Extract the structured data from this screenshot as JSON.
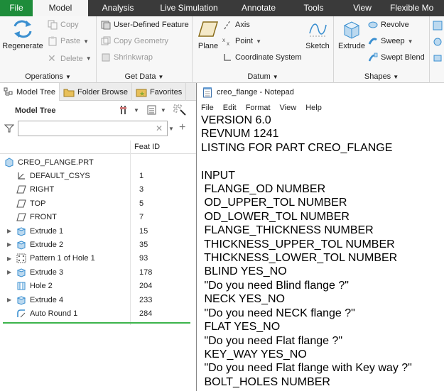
{
  "ribbon_tabs": [
    "File",
    "Model",
    "Analysis",
    "Live Simulation",
    "Annotate",
    "Tools",
    "View",
    "Flexible Mo"
  ],
  "ribbon": {
    "operations": {
      "label": "Operations",
      "regenerate": "Regenerate",
      "copy": "Copy",
      "paste": "Paste",
      "delete": "Delete"
    },
    "get_data": {
      "label": "Get Data",
      "udf": "User-Defined Feature",
      "copy_geometry": "Copy Geometry",
      "shrinkwrap": "Shrinkwrap"
    },
    "datum": {
      "label": "Datum",
      "plane": "Plane",
      "axis": "Axis",
      "point": "Point",
      "coord_sys": "Coordinate System",
      "sketch": "Sketch"
    },
    "shapes": {
      "label": "Shapes",
      "extrude": "Extrude",
      "revolve": "Revolve",
      "sweep": "Sweep",
      "swept_blend": "Swept Blend"
    }
  },
  "panel_tabs": [
    "Model Tree",
    "Folder Browse",
    "Favorites"
  ],
  "model_tree": {
    "title": "Model Tree",
    "filter_placeholder": "",
    "column_feat_id": "Feat ID",
    "items": [
      {
        "label": "CREO_FLANGE.PRT",
        "feat_id": "",
        "icon": "part-icon",
        "expandable": false,
        "indent": 0
      },
      {
        "label": "DEFAULT_CSYS",
        "feat_id": "1",
        "icon": "csys-icon",
        "expandable": false,
        "indent": 1
      },
      {
        "label": "RIGHT",
        "feat_id": "3",
        "icon": "datum-plane-icon",
        "expandable": false,
        "indent": 1
      },
      {
        "label": "TOP",
        "feat_id": "5",
        "icon": "datum-plane-icon",
        "expandable": false,
        "indent": 1
      },
      {
        "label": "FRONT",
        "feat_id": "7",
        "icon": "datum-plane-icon",
        "expandable": false,
        "indent": 1
      },
      {
        "label": "Extrude 1",
        "feat_id": "15",
        "icon": "extrude-icon",
        "expandable": true,
        "indent": 1
      },
      {
        "label": "Extrude 2",
        "feat_id": "35",
        "icon": "extrude-icon",
        "expandable": true,
        "indent": 1
      },
      {
        "label": "Pattern 1 of Hole 1",
        "feat_id": "93",
        "icon": "pattern-icon",
        "expandable": true,
        "indent": 1
      },
      {
        "label": "Extrude 3",
        "feat_id": "178",
        "icon": "extrude-icon",
        "expandable": true,
        "indent": 1
      },
      {
        "label": "Hole 2",
        "feat_id": "204",
        "icon": "hole-icon",
        "expandable": false,
        "indent": 1
      },
      {
        "label": "Extrude 4",
        "feat_id": "233",
        "icon": "extrude-icon",
        "expandable": true,
        "indent": 1
      },
      {
        "label": "Auto Round 1",
        "feat_id": "284",
        "icon": "round-icon",
        "expandable": false,
        "indent": 1
      }
    ]
  },
  "notepad": {
    "title": "creo_flange - Notepad",
    "menu": [
      "File",
      "Edit",
      "Format",
      "View",
      "Help"
    ],
    "lines": [
      "VERSION 6.0",
      "REVNUM 1241",
      "LISTING FOR PART CREO_FLANGE",
      "",
      "INPUT",
      " FLANGE_OD NUMBER",
      " OD_UPPER_TOL NUMBER",
      " OD_LOWER_TOL NUMBER",
      " FLANGE_THICKNESS NUMBER",
      " THICKNESS_UPPER_TOL NUMBER",
      " THICKNESS_LOWER_TOL NUMBER",
      " BLIND YES_NO",
      " \"Do you need Blind flange ?\"",
      " NECK YES_NO",
      " \"Do you need NECK flange ?\"",
      " FLAT YES_NO",
      " \"Do you need Flat flange ?\"",
      " KEY_WAY YES_NO",
      " \"Do you need Flat flange with Key way ?\"",
      " BOLT_HOLES NUMBER"
    ]
  },
  "colors": {
    "file_tab": "#1e8c3a",
    "tabbar": "#3a3a3a",
    "tree_underline": "#3cb44b",
    "icon_blue": "#3a8fd0"
  }
}
